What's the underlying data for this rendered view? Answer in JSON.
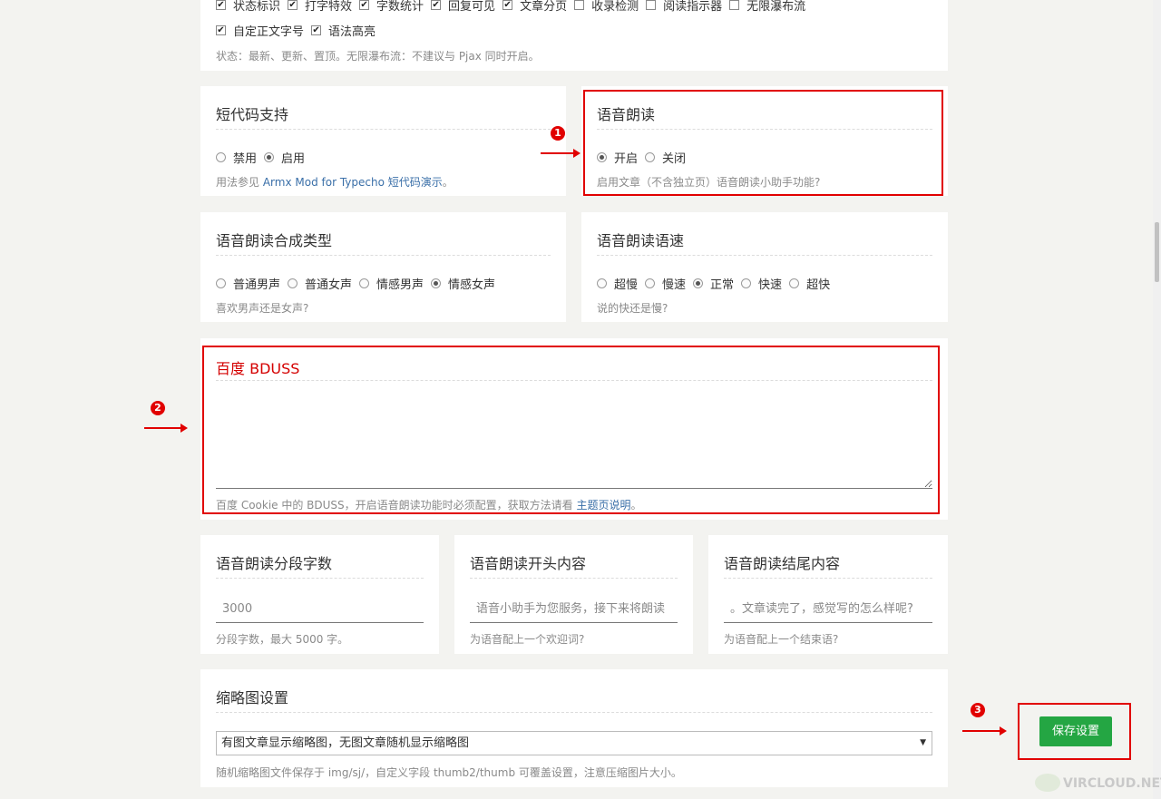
{
  "top_card": {
    "row1": [
      "状态标识",
      "打字特效",
      "字数统计",
      "回复可见",
      "文章分页",
      "收录检测",
      "阅读指示器",
      "无限瀑布流"
    ],
    "row1_checked": [
      true,
      true,
      true,
      true,
      true,
      false,
      false,
      false
    ],
    "row2": [
      "自定正文字号",
      "语法高亮"
    ],
    "desc": "状态：最新、更新、置顶。无限瀑布流：不建议与 Pjax 同时开启。"
  },
  "shortcode": {
    "title": "短代码支持",
    "options": [
      "禁用",
      "启用"
    ],
    "selected": 1,
    "desc_prefix": "用法参见",
    "desc_link": "Armx Mod for Typecho 短代码演示",
    "desc_suffix": "。"
  },
  "voice_read": {
    "title": "语音朗读",
    "options": [
      "开启",
      "关闭"
    ],
    "selected": 0,
    "desc": "启用文章（不含独立页）语音朗读小助手功能?"
  },
  "voice_type": {
    "title": "语音朗读合成类型",
    "options": [
      "普通男声",
      "普通女声",
      "情感男声",
      "情感女声"
    ],
    "selected": 3,
    "desc": "喜欢男声还是女声?"
  },
  "voice_speed": {
    "title": "语音朗读语速",
    "options": [
      "超慢",
      "慢速",
      "正常",
      "快速",
      "超快"
    ],
    "selected": 2,
    "desc": "说的快还是慢?"
  },
  "bduss": {
    "title": "百度 BDUSS",
    "value": "",
    "desc_prefix": "百度 Cookie 中的 BDUSS，开启语音朗读功能时必须配置，获取方法请看",
    "desc_link": "主题页说明",
    "desc_suffix": "。"
  },
  "segment": {
    "title": "语音朗读分段字数",
    "placeholder": "3000",
    "desc": "分段字数，最大 5000 字。"
  },
  "opening": {
    "title": "语音朗读开头内容",
    "placeholder": "语音小助手为您服务，接下来将朗读",
    "desc": "为语音配上一个欢迎词?"
  },
  "ending": {
    "title": "语音朗读结尾内容",
    "placeholder": "。文章读完了，感觉写的怎么样呢?",
    "desc": "为语音配上一个结束语?"
  },
  "thumbnail": {
    "title": "缩略图设置",
    "selected": "有图文章显示缩略图，无图文章随机显示缩略图",
    "desc": "随机缩略图文件保存于 img/sj/，自定义字段 thumb2/thumb 可覆盖设置，注意压缩图片大小。"
  },
  "save_button": "保存设置",
  "annotations": {
    "badge1": "1",
    "badge2": "2",
    "badge3": "3",
    "color": "#e10000"
  },
  "watermark": "VIRCLOUD.NET"
}
